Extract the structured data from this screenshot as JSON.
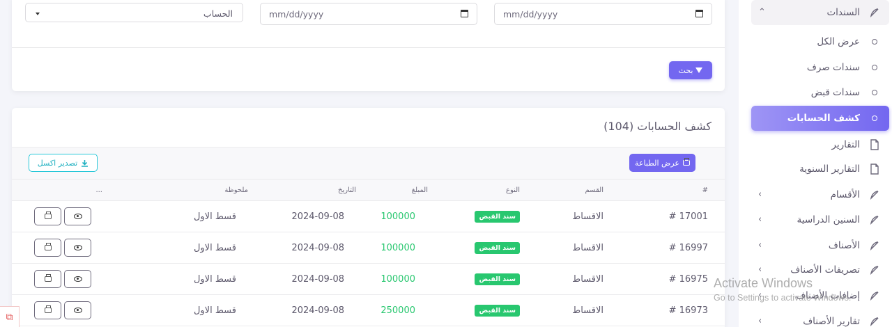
{
  "sidebar": {
    "vouchers": "السندات",
    "show_all": "عرض الكل",
    "payment_vouchers": "سندات صرف",
    "receipt_vouchers": "سندات قبض",
    "account_statement": "كشف الحسابات",
    "reports": "التقارير",
    "annual_reports": "التقارير السنوية",
    "departments": "الأقسام",
    "academic_years": "السنين الدراسية",
    "categories": "الأصناف",
    "category_disbursements": "تصريفات الأصناف",
    "category_additions": "إضافات الأصناف",
    "category_reports": "تقارير الأصناف"
  },
  "filters": {
    "date_placeholder_1": "mm/dd/yyyy",
    "date_placeholder_2": "mm/dd/yyyy",
    "account_select": "الحساب",
    "search_button": "بحث"
  },
  "table": {
    "title": "كشف الحسابات (104)",
    "print_button": "عرض الطباعة",
    "excel_button": "تصدير اكسل",
    "headers": {
      "id": "#",
      "section": "القسم",
      "type": "النوع",
      "amount": "المبلغ",
      "date": "التاريخ",
      "note": "ملحوظة",
      "actions": "..."
    },
    "rows": [
      {
        "id": "# 17001",
        "section": "الاقساط",
        "type": "سند القبض",
        "amount": "100000",
        "date": "2024-09-08",
        "note": "قسط الاول"
      },
      {
        "id": "# 16997",
        "section": "الاقساط",
        "type": "سند القبض",
        "amount": "100000",
        "date": "2024-09-08",
        "note": "قسط الاول"
      },
      {
        "id": "# 16975",
        "section": "الاقساط",
        "type": "سند القبض",
        "amount": "100000",
        "date": "2024-09-08",
        "note": "قسط الاول"
      },
      {
        "id": "# 16973",
        "section": "الاقساط",
        "type": "سند القبض",
        "amount": "250000",
        "date": "2024-09-08",
        "note": "قسط الاول"
      }
    ]
  },
  "watermark": {
    "title": "Activate Windows",
    "subtitle": "Go to Settings to activate Windows."
  },
  "colors": {
    "primary": "#7367f0",
    "success": "#28c76f",
    "info": "#28c7d8"
  }
}
